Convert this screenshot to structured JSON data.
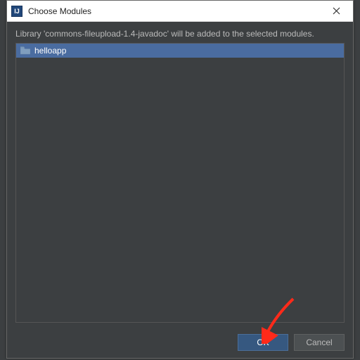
{
  "titlebar": {
    "app_icon_text": "IJ",
    "title": "Choose Modules"
  },
  "instruction": "Library 'commons-fileupload-1.4-javadoc' will be added to the selected modules.",
  "modules": {
    "items": [
      {
        "label": "helloapp",
        "selected": true
      }
    ]
  },
  "buttons": {
    "ok": "OK",
    "cancel": "Cancel"
  }
}
